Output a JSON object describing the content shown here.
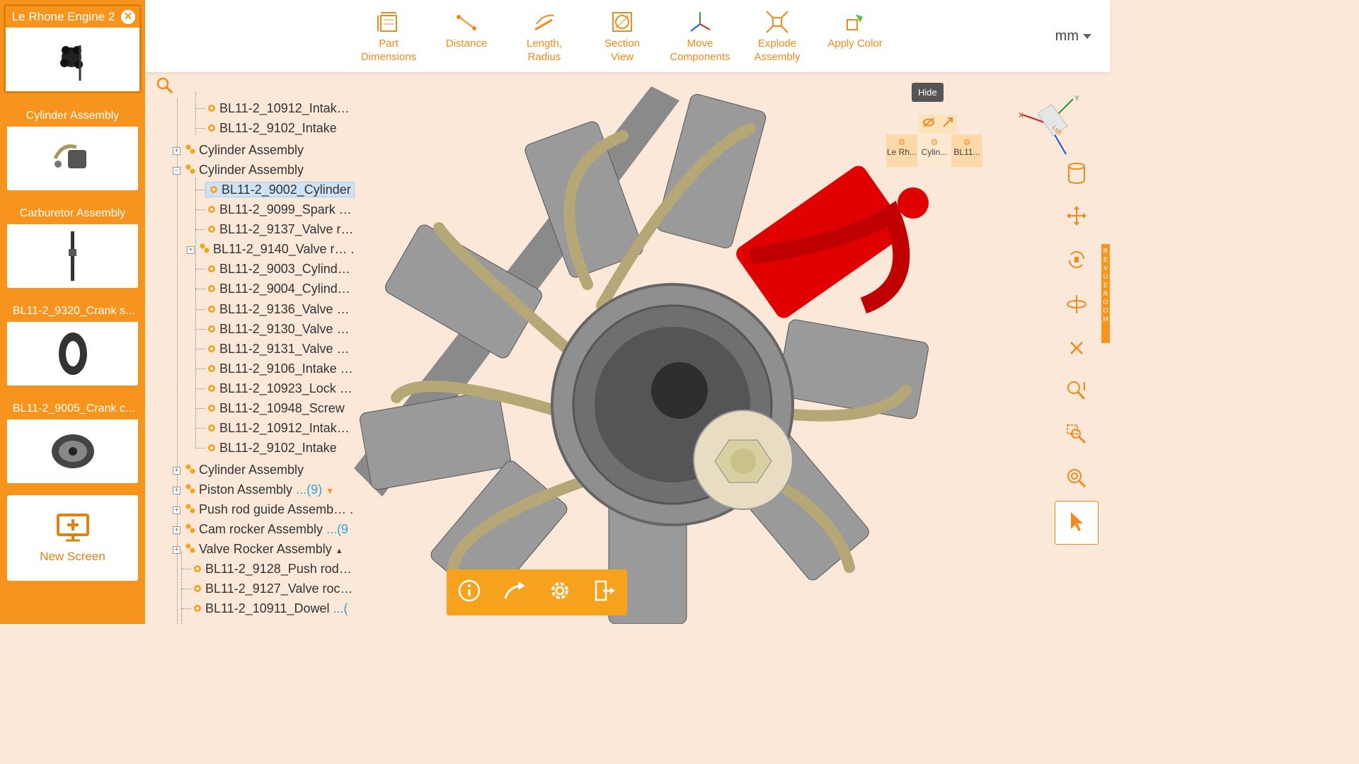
{
  "screens": [
    {
      "title": "Le Rhone Engine 2",
      "active": true
    },
    {
      "title": "Cylinder Assembly"
    },
    {
      "title": "Carburetor Assembly"
    },
    {
      "title": "BL11-2_9320_Crank s..."
    },
    {
      "title": "BL11-2_9005_Crank c..."
    }
  ],
  "new_screen_label": "New Screen",
  "toolbar": {
    "part_dimensions": "Part Dimensions",
    "distance": "Distance",
    "length_radius": "Length, Radius",
    "section_view": "Section View",
    "move_components": "Move Components",
    "explode_assembly": "Explode Assembly",
    "apply_color": "Apply Color",
    "unit": "mm"
  },
  "tree": {
    "rows": [
      {
        "label": "BL11-2_10912_Intak…"
      },
      {
        "label": "BL11-2_9102_Intake"
      },
      {
        "label": "Cylinder Assembly"
      },
      {
        "label": "Cylinder Assembly"
      },
      {
        "label": "BL11-2_9002_Cylinder"
      },
      {
        "label": "BL11-2_9099_Spark …"
      },
      {
        "label": "BL11-2_9137_Valve r…"
      },
      {
        "label": "BL11-2_9140_Valve r… ."
      },
      {
        "label": "BL11-2_9003_Cylind…"
      },
      {
        "label": "BL11-2_9004_Cylind…"
      },
      {
        "label": "BL11-2_9136_Valve …"
      },
      {
        "label": "BL11-2_9130_Valve …"
      },
      {
        "label": "BL11-2_9131_Valve …"
      },
      {
        "label": "BL11-2_9106_Intake …"
      },
      {
        "label": "BL11-2_10923_Lock …"
      },
      {
        "label": "BL11-2_10948_Screw"
      },
      {
        "label": "BL11-2_10912_Intak…"
      },
      {
        "label": "BL11-2_9102_Intake"
      },
      {
        "label": "Cylinder Assembly"
      },
      {
        "label": "Piston Assembly",
        "count": "...(9)"
      },
      {
        "label": "Push rod guide Assemb… ."
      },
      {
        "label": "Cam rocker Assembly",
        "count": "...(9"
      },
      {
        "label": "Valve Rocker Assembly"
      },
      {
        "label": "BL11-2_9128_Push rod…"
      },
      {
        "label": "BL11-2_9127_Valve roc…"
      },
      {
        "label": "BL11-2_10911_Dowel",
        "count": "...("
      }
    ]
  },
  "popup": {
    "tooltip": "Hide",
    "crumbs": [
      "Le Rh...",
      "Cylin...",
      "BL11..."
    ]
  },
  "side_tab": "REVUE ROOM",
  "cube_label": "Left",
  "colors": {
    "accent": "#f7941d",
    "highlight": "#e00000"
  }
}
